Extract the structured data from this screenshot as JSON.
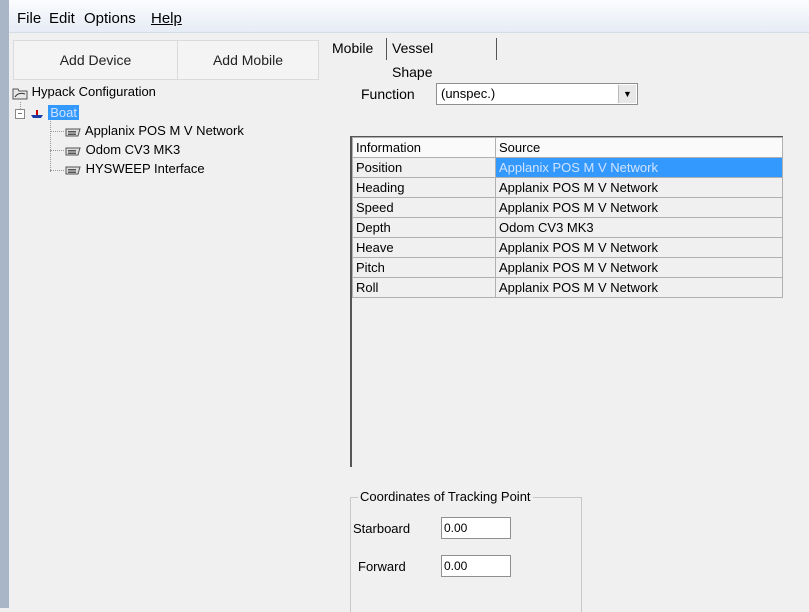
{
  "menu": {
    "file": "File",
    "edit": "Edit",
    "options": "Options",
    "help": "Help"
  },
  "toolbar": {
    "add_device": "Add Device",
    "add_mobile": "Add Mobile"
  },
  "tree": {
    "root": "Hypack Configuration",
    "boat": "Boat",
    "devices": [
      "Applanix POS M V Network",
      "Odom CV3 MK3",
      "HYSWEEP Interface"
    ]
  },
  "tabs": {
    "mobile": "Mobile",
    "vessel_shape": "Vessel Shape"
  },
  "function": {
    "label": "Function",
    "value": "(unspec.)"
  },
  "grid": {
    "headers": [
      "Information",
      "Source"
    ],
    "rows": [
      [
        "Position",
        "Applanix POS M V Network"
      ],
      [
        "Heading",
        "Applanix POS M V Network"
      ],
      [
        "Speed",
        "Applanix POS M V Network"
      ],
      [
        "Depth",
        "Odom CV3 MK3"
      ],
      [
        "Heave",
        "Applanix POS M V Network"
      ],
      [
        "Pitch",
        "Applanix POS M V Network"
      ],
      [
        "Roll",
        "Applanix POS M V Network"
      ]
    ],
    "selected_row": 0
  },
  "tracking": {
    "title": "Coordinates of Tracking Point",
    "starboard_label": "Starboard",
    "starboard_value": "0.00",
    "forward_label": "Forward",
    "forward_value": "0.00"
  },
  "colors": {
    "selection": "#3399ff",
    "tree_selection": "#3399ff"
  }
}
